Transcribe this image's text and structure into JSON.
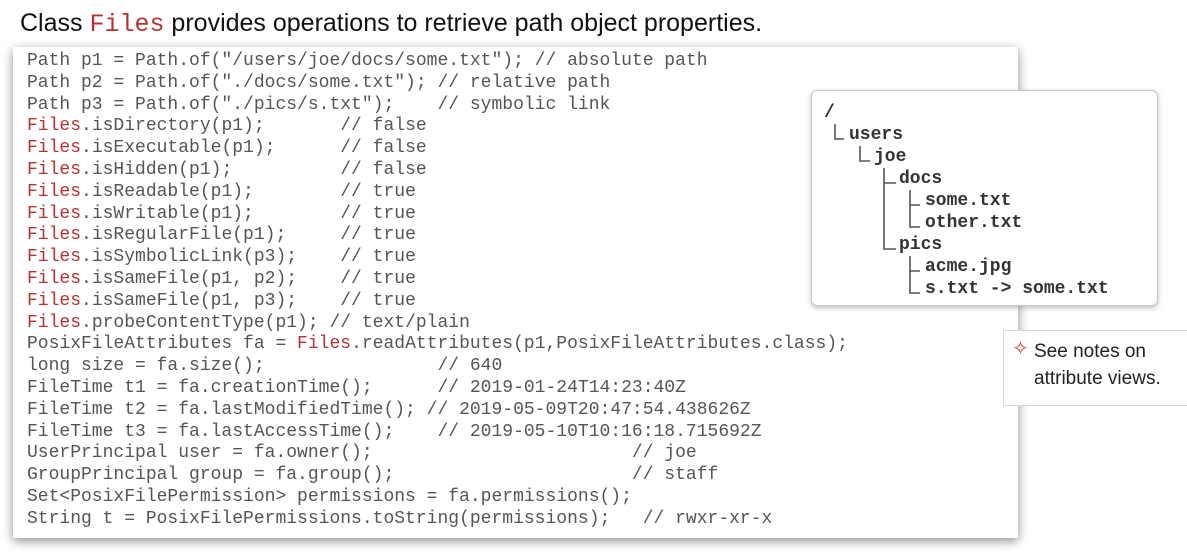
{
  "title": {
    "prefix": "Class ",
    "class_name": "Files",
    "suffix": " provides operations to retrieve path object properties."
  },
  "code": {
    "lines": [
      [
        {
          "t": "Path p1 = Path.of(\"/users/joe/docs/some.txt\"); // absolute path"
        }
      ],
      [
        {
          "t": "Path p2 = Path.of(\"./docs/some.txt\"); // relative path"
        }
      ],
      [
        {
          "t": "Path p3 = Path.of(\"./pics/s.txt\");    // symbolic link"
        }
      ],
      [
        {
          "t": "Files",
          "k": 1
        },
        {
          "t": ".isDirectory(p1);       // false"
        }
      ],
      [
        {
          "t": "Files",
          "k": 1
        },
        {
          "t": ".isExecutable(p1);      // false"
        }
      ],
      [
        {
          "t": "Files",
          "k": 1
        },
        {
          "t": ".isHidden(p1);          // false"
        }
      ],
      [
        {
          "t": "Files",
          "k": 1
        },
        {
          "t": ".isReadable(p1);        // true"
        }
      ],
      [
        {
          "t": "Files",
          "k": 1
        },
        {
          "t": ".isWritable(p1);        // true"
        }
      ],
      [
        {
          "t": "Files",
          "k": 1
        },
        {
          "t": ".isRegularFile(p1);     // true"
        }
      ],
      [
        {
          "t": "Files",
          "k": 1
        },
        {
          "t": ".isSymbolicLink(p3);    // true"
        }
      ],
      [
        {
          "t": "Files",
          "k": 1
        },
        {
          "t": ".isSameFile(p1, p2);    // true"
        }
      ],
      [
        {
          "t": "Files",
          "k": 1
        },
        {
          "t": ".isSameFile(p1, p3);    // true"
        }
      ],
      [
        {
          "t": "Files",
          "k": 1
        },
        {
          "t": ".probeContentType(p1); // text/plain"
        }
      ],
      [
        {
          "t": "PosixFileAttributes fa = "
        },
        {
          "t": "Files",
          "k": 1
        },
        {
          "t": ".readAttributes(p1,PosixFileAttributes.class);"
        }
      ],
      [
        {
          "t": "long size = fa.size();                // 640"
        }
      ],
      [
        {
          "t": "FileTime t1 = fa.creationTime();      // 2019-01-24T14:23:40Z"
        }
      ],
      [
        {
          "t": "FileTime t2 = fa.lastModifiedTime(); // 2019-05-09T20:47:54.438626Z"
        }
      ],
      [
        {
          "t": "FileTime t3 = fa.lastAccessTime();    // 2019-05-10T10:16:18.715692Z"
        }
      ],
      [
        {
          "t": "UserPrincipal user = fa.owner();                        // joe"
        }
      ],
      [
        {
          "t": "GroupPrincipal group = fa.group();                      // staff"
        }
      ],
      [
        {
          "t": "Set<PosixFilePermission> permissions = fa.permissions();"
        }
      ],
      [
        {
          "t": "String t = PosixFilePermissions.toString(permissions);   // rwxr-xr-x"
        }
      ]
    ]
  },
  "tree": {
    "root": "/",
    "users": "users",
    "joe": "joe",
    "docs": "docs",
    "some_txt": "some.txt",
    "other_txt": "other.txt",
    "pics": "pics",
    "acme_jpg": "acme.jpg",
    "s_txt": "s.txt -> some.txt"
  },
  "note": {
    "icon": "cross-bullet-icon",
    "icon_color": "#c9482f",
    "text": "See notes on attribute views."
  },
  "colors": {
    "keyword": "#b8312f",
    "code_text": "#555555"
  }
}
